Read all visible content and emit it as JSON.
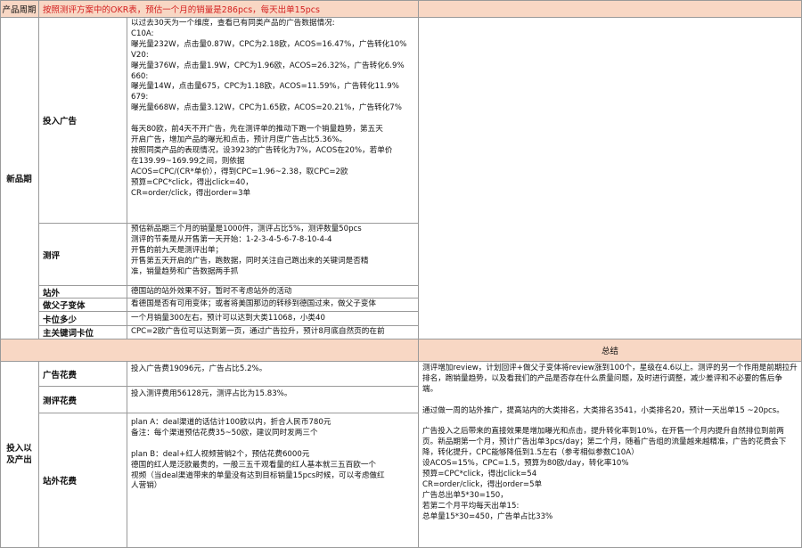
{
  "header": {
    "label": "产品周期",
    "text": "按照测评方案中的OKR表，预估一个月的销量是286pcs，预估一个月的销量是286pcs，每天出单15pcs"
  },
  "sections": {
    "new_product": {
      "label": "新品期",
      "rows": [
        {
          "label": "投入广告",
          "content": " 以过去30天为一个维度，查看已有同类产品的广告数据情况:\nC10A:\n曝光量232W，点击量0.87W，CPC为2.18欧，ACOS=16.47%，广告转化10%\nV20:\n曝光量376W，点击量1.9W，CPC为1.96欧，ACOS=26.32%，广告转化6.9%\n660:\n曝光量14W，点击量675，CPC为1.18欧，ACOS=11.59%，广告转化11.9%\n679:\n曝光量668W，点击量3.12W，CPC为1.65欧，ACOS=20.21%，广告转化7%\n\n每天80欧，前4天不开广告，先在测评单的推动下跑一个销量趋势，第五天\n开启广告，增加产品的曝光和点击，预计月度广告占比5.36%。\n按照同类产品的表现情况，设3923的广告转化为7%，ACOS在20%，若单价\n在139.99~169.99之间，则依据\nACOS=CPC/(CR*单价），得到CPC=1.96~2.38，取CPC=2欧\n预算=CPC*click，得出click=40，\nCR=order/click，得出order=3单"
        },
        {
          "label": "测评",
          "content": "  预估新品期三个月的销量是1000件，测评占比5%，测评数量50pcs\n测评的节奏是从开售第一天开始：1-2-3-4-5-6-7-8-10-4-4\n开售的前九天是测评出单；\n开售第五天开启的广告，跑数据，同时关注自己跑出来的关键词是否精\n准，销量趋势和广告数据两手抓"
        },
        {
          "label": "站外",
          "content": "德国站的站外效果不好，暂时不考虑站外的活动"
        },
        {
          "label": "做父子变体",
          "content": "看德国是否有可用变体；或者将美国那边的转移到德国过来，做父子变体"
        },
        {
          "label": "卡位多少",
          "content": " 一个月销量300左右，预计可以达到大类11068，小类40"
        },
        {
          "label": "主关键词卡位",
          "content": "CPC=2欧广告位可以达到第一页，通过广告拉升，预计8月底自然页的在前"
        }
      ]
    },
    "summary_header": "总结",
    "investment": {
      "label": "投入以\n及产出",
      "rows": [
        {
          "label": "广告花费",
          "content": "  投入广告费19096元，广告占比5.2%。"
        },
        {
          "label": "测评花费",
          "content": "  投入测评费用56128元，测评占比为15.83%。"
        },
        {
          "label": "站外花费",
          "content": "  plan A：deal渠道的话估计100欧以内，折合人民币780元\n  备注：每个渠道预估花费35~50欧，建议同时发两三个\n\n  plan B：deal+红人视频营销2个，预估花费6000元\n  德国的红人是泛欧最贵的，一般三五千观看量的红人基本就三五百欧一个\n  视频（当deal渠道带来的单量没有达到目标销量15pcs时候，可以考虑做红\n  人营销）"
        }
      ],
      "summary": "测评增加review，计划回评+做父子变体将review涨到100个，星级在4.6以上。测评的另一个作用是前期拉升排名，跑销量趋势，以及看我们的产品是否存在什么质量问题，及时进行调整，减少差评和不必要的售后争端。\n\n通过做一周的站外推广，提高站内的大类排名，大类排名3541，小类排名20，预计一天出单15 ~20pcs。\n\n广告投入之后带来的直接效果是增加曝光和点击，提升转化率到10%，在开售一个月内提升自然排位到前两页。新品期第一个月，预计广告出单3pcs/day；第二个月，随着广告组的流量越来越精准，广告的花费会下降，转化提升，CPC能够降低到1.5左右（参考相似参数C10A）\n设ACOS=15%，CPC=1.5，预算为80欧/day，转化率10%\n预算=CPC*click，得出click=54\nCR=order/click，得出order=5单\n广告总出单5*30=150，\n若第二个月平均每天出单15:\n总单量15*30=450，广告单占比33%"
    }
  }
}
